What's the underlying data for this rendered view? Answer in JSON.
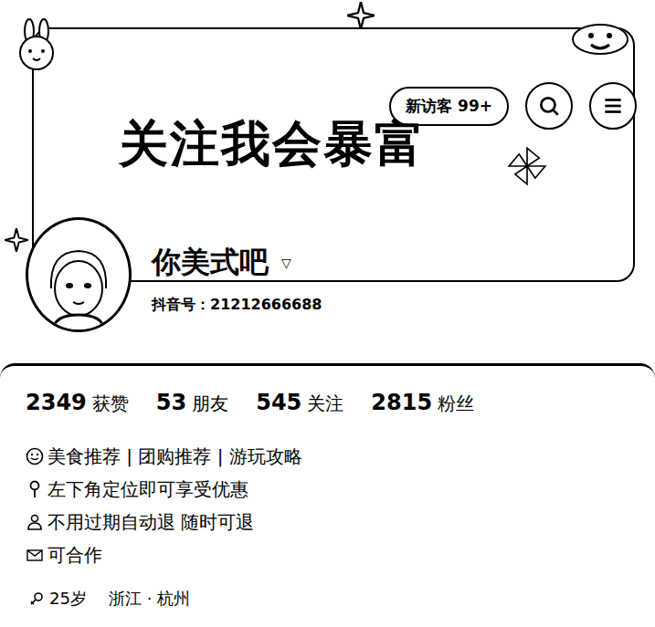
{
  "header": {
    "slogan": "关注我会暴富",
    "visitor_badge": "新访客 99+"
  },
  "profile": {
    "name": "你美式吧",
    "name_caret": "▽",
    "account": "抖音号：21212666688"
  },
  "stats": [
    {
      "value": "2349",
      "label": "获赞"
    },
    {
      "value": "53",
      "label": "朋友"
    },
    {
      "value": "545",
      "label": "关注"
    },
    {
      "value": "2815",
      "label": "粉丝"
    }
  ],
  "bio": [
    {
      "kind": "food",
      "text": "美食推荐 | 团购推荐 | 游玩攻略"
    },
    {
      "kind": "location",
      "text": "左下角定位即可享受优惠"
    },
    {
      "kind": "service",
      "text": "不用过期自动退 随时可退"
    },
    {
      "kind": "cooperation",
      "text": "可合作"
    }
  ],
  "tags": [
    {
      "kind": "age",
      "text": "25岁"
    },
    {
      "kind": "place",
      "text": "浙江 · 杭州"
    }
  ]
}
